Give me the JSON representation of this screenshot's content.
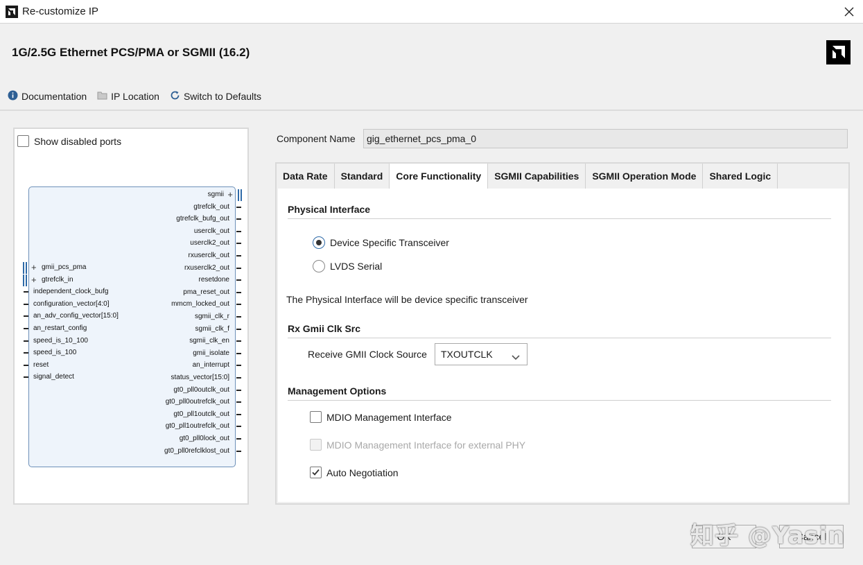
{
  "window": {
    "title": "Re-customize IP"
  },
  "header": {
    "ip_title": "1G/2.5G Ethernet PCS/PMA or SGMII (16.2)",
    "toolbar": [
      {
        "label": "Documentation",
        "icon": "info-icon"
      },
      {
        "label": "IP Location",
        "icon": "folder-icon"
      },
      {
        "label": "Switch to Defaults",
        "icon": "refresh-icon"
      }
    ]
  },
  "left_panel": {
    "show_disabled_ports_label": "Show disabled ports",
    "show_disabled_ports_checked": false,
    "left_ports": [
      {
        "name": "gmii_pcs_pma",
        "bus": true
      },
      {
        "name": "gtrefclk_in",
        "bus": true
      },
      {
        "name": "independent_clock_bufg",
        "bus": false
      },
      {
        "name": "configuration_vector[4:0]",
        "bus": false
      },
      {
        "name": "an_adv_config_vector[15:0]",
        "bus": false
      },
      {
        "name": "an_restart_config",
        "bus": false
      },
      {
        "name": "speed_is_10_100",
        "bus": false
      },
      {
        "name": "speed_is_100",
        "bus": false
      },
      {
        "name": "reset",
        "bus": false
      },
      {
        "name": "signal_detect",
        "bus": false
      }
    ],
    "right_ports": [
      {
        "name": "sgmii",
        "bus": true
      },
      {
        "name": "gtrefclk_out",
        "bus": false
      },
      {
        "name": "gtrefclk_bufg_out",
        "bus": false
      },
      {
        "name": "userclk_out",
        "bus": false
      },
      {
        "name": "userclk2_out",
        "bus": false
      },
      {
        "name": "rxuserclk_out",
        "bus": false
      },
      {
        "name": "rxuserclk2_out",
        "bus": false
      },
      {
        "name": "resetdone",
        "bus": false
      },
      {
        "name": "pma_reset_out",
        "bus": false
      },
      {
        "name": "mmcm_locked_out",
        "bus": false
      },
      {
        "name": "sgmii_clk_r",
        "bus": false
      },
      {
        "name": "sgmii_clk_f",
        "bus": false
      },
      {
        "name": "sgmii_clk_en",
        "bus": false
      },
      {
        "name": "gmii_isolate",
        "bus": false
      },
      {
        "name": "an_interrupt",
        "bus": false
      },
      {
        "name": "status_vector[15:0]",
        "bus": false
      },
      {
        "name": "gt0_pll0outclk_out",
        "bus": false
      },
      {
        "name": "gt0_pll0outrefclk_out",
        "bus": false
      },
      {
        "name": "gt0_pll1outclk_out",
        "bus": false
      },
      {
        "name": "gt0_pll1outrefclk_out",
        "bus": false
      },
      {
        "name": "gt0_pll0lock_out",
        "bus": false
      },
      {
        "name": "gt0_pll0refclklost_out",
        "bus": false
      }
    ]
  },
  "component": {
    "label": "Component Name",
    "value": "gig_ethernet_pcs_pma_0"
  },
  "tabs": [
    {
      "label": "Data Rate",
      "active": false
    },
    {
      "label": "Standard",
      "active": false
    },
    {
      "label": "Core Functionality",
      "active": true
    },
    {
      "label": "SGMII Capabilities",
      "active": false
    },
    {
      "label": "SGMII Operation Mode",
      "active": false
    },
    {
      "label": "Shared Logic",
      "active": false
    }
  ],
  "core": {
    "physical_interface_title": "Physical Interface",
    "radio_options": [
      {
        "label": "Device Specific Transceiver",
        "selected": true
      },
      {
        "label": "LVDS Serial",
        "selected": false
      }
    ],
    "description": "The Physical Interface will be device specific transceiver",
    "rx_title": "Rx Gmii Clk Src",
    "rx_label": "Receive GMII Clock Source",
    "rx_value": "TXOUTCLK",
    "mgmt_title": "Management Options",
    "checkboxes": [
      {
        "label": "MDIO Management Interface",
        "checked": false,
        "disabled": false
      },
      {
        "label": "MDIO Management Interface for external PHY",
        "checked": false,
        "disabled": true
      },
      {
        "label": "Auto Negotiation",
        "checked": true,
        "disabled": false
      }
    ]
  },
  "buttons": {
    "ok": "OK",
    "cancel": "Cancel"
  },
  "watermark": "知乎 @Yasin",
  "colors": {
    "accent": "#2e6aa8",
    "symbol_fill": "#eef4fb",
    "symbol_border": "#6d90b8"
  }
}
